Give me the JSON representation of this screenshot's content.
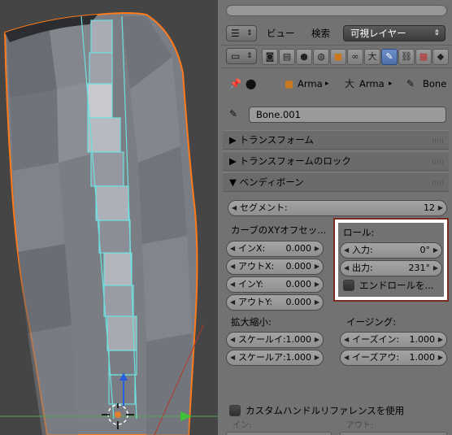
{
  "header": {
    "view_menu": "ビュー",
    "search_menu": "検索",
    "layer_dropdown": "可視レイヤー"
  },
  "context_icons": [
    "render-icon",
    "render-layers-icon",
    "scene-icon",
    "world-icon",
    "object-icon",
    "constraint-icon",
    "armature-data-icon",
    "bone-icon",
    "bone-constraint-icon",
    "material-icon"
  ],
  "breadcrumb": {
    "item1": "Arma",
    "item2": "Arma",
    "item3": "Bone"
  },
  "bone_name": "Bone.001",
  "panels": {
    "transform": "トランスフォーム",
    "transform_lock": "トランスフォームのロック",
    "bendy_bones": "ベンディボーン"
  },
  "segments": {
    "label": "セグメント:",
    "value": "12"
  },
  "curve_offsets": {
    "title": "カーブのXYオフセッ...",
    "in_x": {
      "label": "インX:",
      "value": "0.000"
    },
    "out_x": {
      "label": "アウトX:",
      "value": "0.000"
    },
    "in_y": {
      "label": "インY:",
      "value": "0.000"
    },
    "out_y": {
      "label": "アウトY:",
      "value": "0.000"
    }
  },
  "roll": {
    "title": "ロール:",
    "in": {
      "label": "入力:",
      "value": "0°"
    },
    "out": {
      "label": "出力:",
      "value": "231°"
    },
    "end_roll": "エンドロールを..."
  },
  "scale": {
    "title": "拡大縮小:",
    "scale_in": {
      "label": "スケールイ:",
      "value": "1.000"
    },
    "scale_out": {
      "label": "スケールア:",
      "value": "1.000"
    }
  },
  "easing": {
    "title": "イージング:",
    "ease_in": {
      "label": "イーズイン:",
      "value": "1.000"
    },
    "ease_out": {
      "label": "イーズアウ:",
      "value": "1.000"
    }
  },
  "custom_handle": {
    "label": "カスタムハンドルリファレンスを使用",
    "in_label": "イン:",
    "out_label": "アウト:"
  },
  "colors": {
    "active_tab": "#5a7cb8",
    "highlight_box": "#7a2a1e",
    "selection_outline": "#ff7a1a",
    "bone_wire": "#6fe0e0"
  }
}
